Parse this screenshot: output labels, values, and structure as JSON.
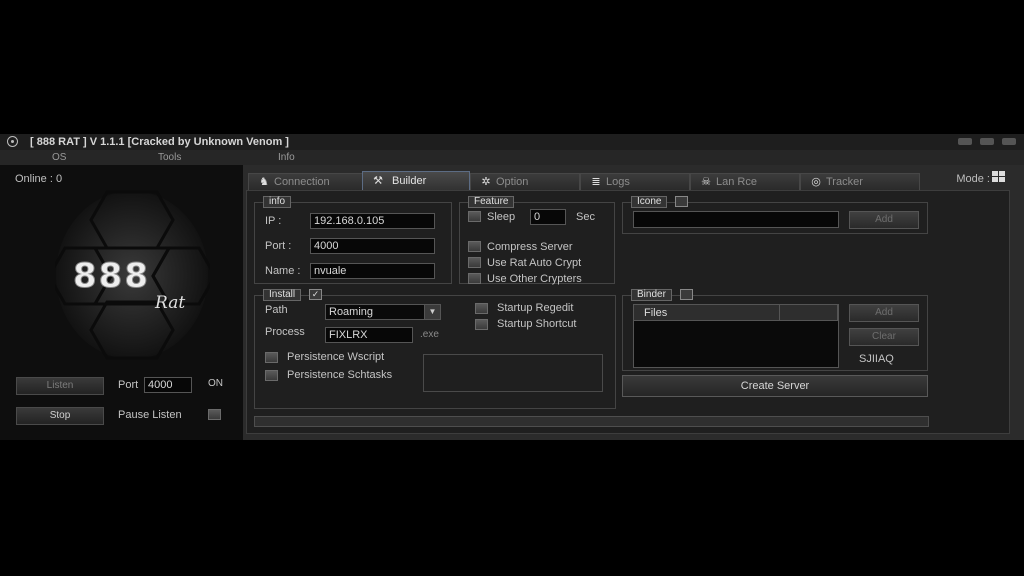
{
  "window": {
    "title": "[ 888 RAT ] V 1.1.1 [Cracked by Unknown Venom ]"
  },
  "menu": [
    "OS",
    "Tools",
    "Info"
  ],
  "left_panel": {
    "online_label": "Online : 0",
    "logo_number": "888",
    "logo_sub": "Rat",
    "listen_button": "Listen",
    "stop_button": "Stop",
    "port_label": "Port",
    "port_value": "4000",
    "status": "ON",
    "pause_listen_label": "Pause Listen"
  },
  "mode_label": "Mode :",
  "tabs": [
    {
      "label": "Connection",
      "icon": "plug-icon",
      "glyph": "♞",
      "active": false
    },
    {
      "label": "Builder",
      "icon": "tools-icon",
      "glyph": "⚒",
      "active": true
    },
    {
      "label": "Option",
      "icon": "gear-icon",
      "glyph": "✲",
      "active": false
    },
    {
      "label": "Logs",
      "icon": "list-icon",
      "glyph": "≣",
      "active": false
    },
    {
      "label": "Lan Rce",
      "icon": "skull-icon",
      "glyph": "☠",
      "active": false
    },
    {
      "label": "Tracker",
      "icon": "globe-icon",
      "glyph": "◎",
      "active": false
    }
  ],
  "builder": {
    "info": {
      "legend": "info",
      "ip_label": "IP :",
      "ip_value": "192.168.0.105",
      "port_label": "Port :",
      "port_value": "4000",
      "name_label": "Name :",
      "name_value": "nvuale"
    },
    "feature": {
      "legend": "Feature",
      "sleep_label": "Sleep",
      "sleep_value": "0",
      "sec_label": "Sec",
      "compress_label": "Compress Server",
      "autocrypt_label": "Use Rat Auto Crypt",
      "other_crypters_label": "Use Other Crypters",
      "startup_regedit_label": "Startup Regedit",
      "startup_shortcut_label": "Startup Shortcut"
    },
    "icone": {
      "legend": "Icone",
      "path_value": "",
      "add_button": "Add"
    },
    "install": {
      "legend": "Install",
      "checked_glyph": "✓",
      "path_label": "Path",
      "path_value": "Roaming",
      "process_label": "Process",
      "process_value": "FIXLRX",
      "ext_label": ".exe",
      "persistence_wscript_label": "Persistence Wscript",
      "persistence_schtasks_label": "Persistence Schtasks"
    },
    "binder": {
      "legend": "Binder",
      "files_header": "Files",
      "add_button": "Add",
      "clear_button": "Clear",
      "code": "SJIIAQ"
    },
    "create_server_button": "Create Server",
    "progress_percent": 0
  }
}
